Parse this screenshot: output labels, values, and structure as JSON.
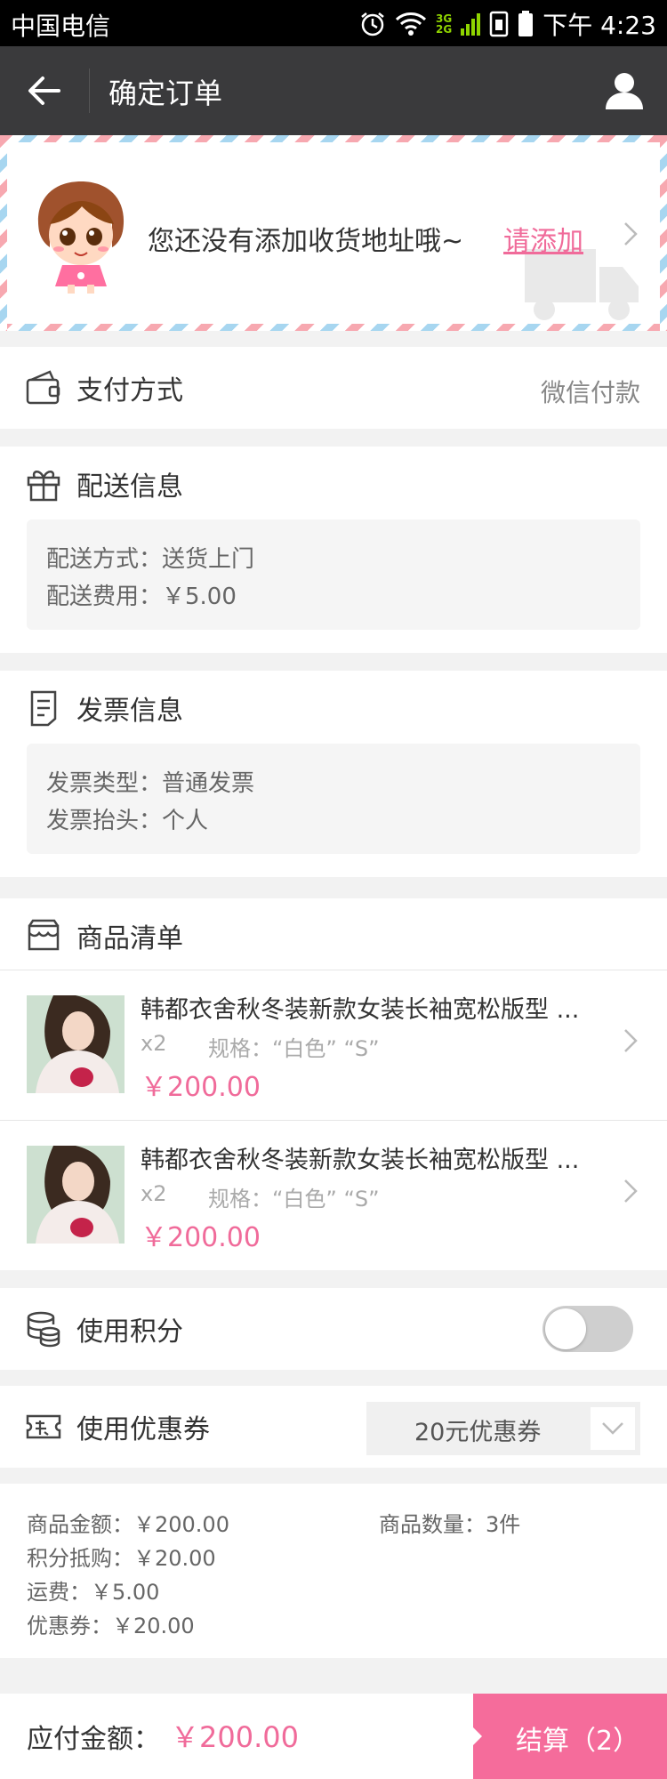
{
  "status_bar": {
    "carrier": "中国电信",
    "network": [
      "3G",
      "2G"
    ],
    "time": "下午 4:23"
  },
  "header": {
    "title": "确定订单"
  },
  "address": {
    "message": "您还没有添加收货地址哦~",
    "add_link": "请添加"
  },
  "payment": {
    "label": "支付方式",
    "value": "微信付款"
  },
  "delivery": {
    "label": "配送信息",
    "method_label": "配送方式：送货上门",
    "fee_label": "配送费用：￥5.00"
  },
  "invoice": {
    "label": "发票信息",
    "type_label": "发票类型：普通发票",
    "header_label": "发票抬头：个人"
  },
  "products": {
    "label": "商品清单",
    "items": [
      {
        "name": "韩都衣舍秋冬装新款女装长袖宽松版型 ...",
        "qty": "x2",
        "spec": "规格：“白色”  “S”",
        "price": "￥200.00"
      },
      {
        "name": "韩都衣舍秋冬装新款女装长袖宽松版型 ...",
        "qty": "x2",
        "spec": "规格：“白色”  “S”",
        "price": "￥200.00"
      }
    ]
  },
  "points": {
    "label": "使用积分",
    "enabled": false
  },
  "coupon": {
    "label": "使用优惠券",
    "selected": "20元优惠券"
  },
  "summary": {
    "goods_amount": "商品金额：￥200.00",
    "goods_count": "商品数量：3件",
    "points_deduct": "积分抵购：￥20.00",
    "shipping": "运费：￥5.00",
    "coupon": "优惠券：￥20.00"
  },
  "footer": {
    "payable_label": "应付金额：",
    "payable_amount": "￥200.00",
    "checkout_label": "结算（2）"
  },
  "colors": {
    "accent": "#f06b9a",
    "checkout_bg": "#f56c9b",
    "titlebar_bg": "#3a3a3c"
  }
}
